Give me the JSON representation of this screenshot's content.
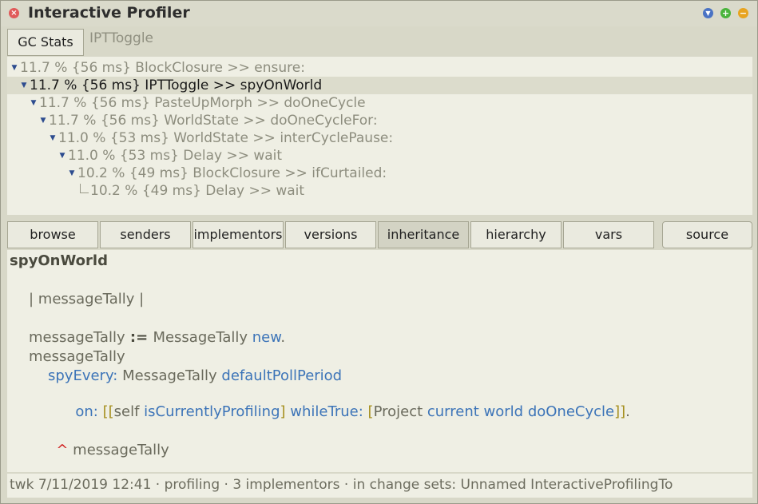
{
  "window": {
    "title": "Interactive Profiler",
    "close_glyph": "×",
    "collapse_glyph": "▼",
    "expand_glyph": "+",
    "menu_glyph": "−"
  },
  "toolbar": {
    "gc_stats_label": "GC Stats",
    "toggle_label": "IPTToggle"
  },
  "tree": [
    {
      "text": "11.7 % {56 ms} BlockClosure >> ensure:",
      "depth": 0,
      "expanded": true,
      "selected": false
    },
    {
      "text": "11.7 % {56 ms} IPTToggle >> spyOnWorld",
      "depth": 1,
      "expanded": true,
      "selected": true
    },
    {
      "text": "11.7 % {56 ms} PasteUpMorph >> doOneCycle",
      "depth": 2,
      "expanded": true,
      "selected": false
    },
    {
      "text": "11.7 % {56 ms} WorldState >> doOneCycleFor:",
      "depth": 3,
      "expanded": true,
      "selected": false
    },
    {
      "text": "11.0 % {53 ms} WorldState >> interCyclePause:",
      "depth": 4,
      "expanded": true,
      "selected": false
    },
    {
      "text": "11.0 % {53 ms} Delay >> wait",
      "depth": 5,
      "expanded": true,
      "selected": false
    },
    {
      "text": "10.2 % {49 ms} BlockClosure >> ifCurtailed:",
      "depth": 6,
      "expanded": true,
      "selected": false
    },
    {
      "text": "10.2 % {49 ms} Delay >> wait",
      "depth": 7,
      "expanded": false,
      "selected": false
    }
  ],
  "buttons": {
    "browse": "browse",
    "senders": "senders",
    "implementors": "implementors",
    "versions": "versions",
    "inheritance": "inheritance",
    "hierarchy": "hierarchy",
    "vars": "vars",
    "source": "source"
  },
  "code": {
    "selector": "spyOnWorld",
    "temps": "| messageTally |",
    "l3_var": "messageTally",
    "l3_assign": " := ",
    "l3_class": "MessageTally",
    "l3_new": "new",
    "l3_dot": ".",
    "l4": "messageTally",
    "l5_kw": "spyEvery:",
    "l5_class": " MessageTally ",
    "l5_msg": "defaultPollPeriod",
    "l6_kw": "on:",
    "l6_sp": " ",
    "l6_b1": "[[",
    "l6_self": "self ",
    "l6_msg": "isCurrentlyProfiling",
    "l6_b2": "]",
    "l6_sp2": " ",
    "l6_while": "whileTrue:",
    "l6_sp3": " ",
    "l6_b3": "[",
    "l6_project": "Project ",
    "l6_chain": "current world doOneCycle",
    "l6_b4": "]]",
    "l6_dot": ".",
    "caret": "^",
    "ret": " messageTally"
  },
  "status": "twk 7/11/2019 12:41 · profiling · 3 implementors · in change sets: Unnamed InteractiveProfilingTo"
}
